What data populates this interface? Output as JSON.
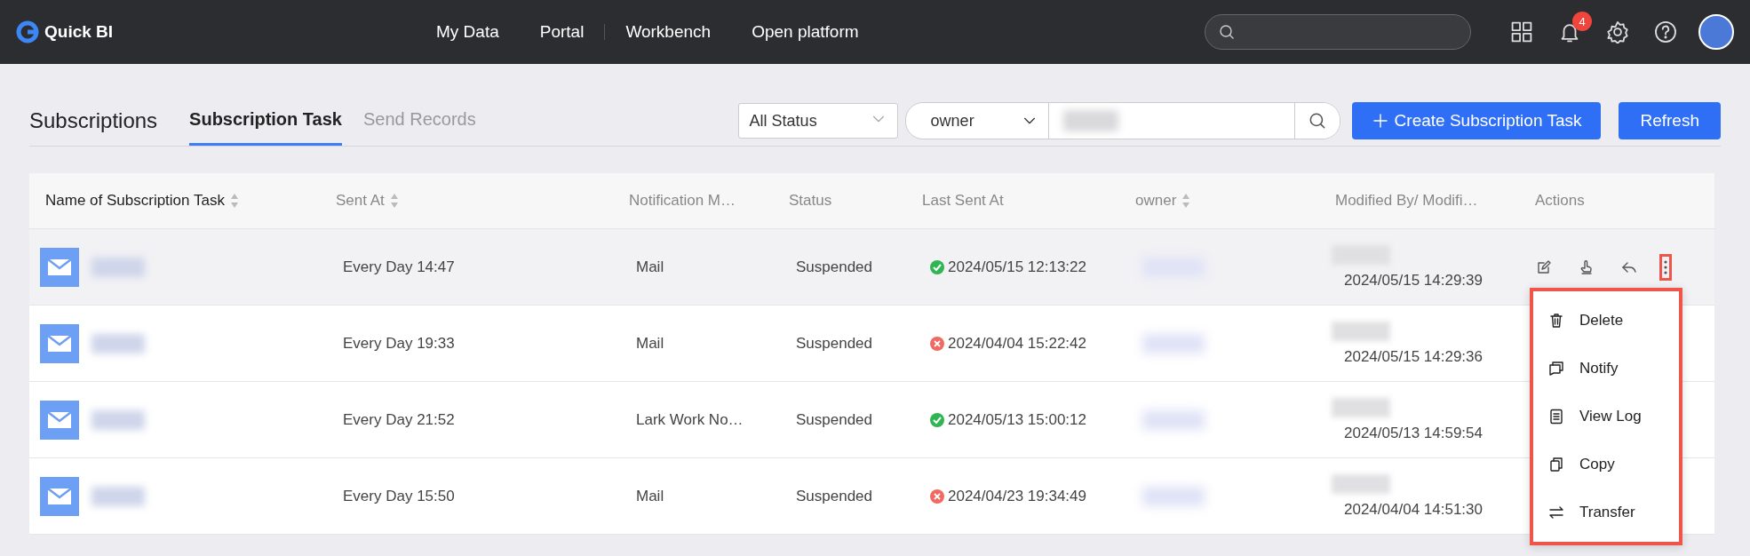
{
  "topbar": {
    "logo": "Quick BI",
    "nav": [
      {
        "label": "My Data"
      },
      {
        "label": "Portal"
      },
      {
        "label": "Workbench"
      },
      {
        "label": "Open platform"
      }
    ],
    "notification_count": "4"
  },
  "page": {
    "title": "Subscriptions",
    "tabs": [
      {
        "label": "Subscription Task",
        "selected": true
      },
      {
        "label": "Send Records",
        "selected": false
      }
    ],
    "status_filter": "All Status",
    "field_filter": "owner",
    "create_button": "Create Subscription Task",
    "refresh_button": "Refresh"
  },
  "table": {
    "columns": [
      {
        "label": "Name of Subscription Task",
        "sortable": true,
        "highlighted": true
      },
      {
        "label": "Sent At",
        "sortable": true,
        "highlighted": false
      },
      {
        "label": "Notification M…",
        "sortable": false,
        "highlighted": false
      },
      {
        "label": "Status",
        "sortable": false,
        "highlighted": false
      },
      {
        "label": "Last Sent At",
        "sortable": false,
        "highlighted": false
      },
      {
        "label": "owner",
        "sortable": true,
        "highlighted": false
      },
      {
        "label": "Modified By/ Modifi…",
        "sortable": false,
        "highlighted": false
      },
      {
        "label": "Actions",
        "sortable": false,
        "highlighted": false
      }
    ],
    "rows": [
      {
        "sent_at": "Every Day 14:47",
        "method": "Mail",
        "status": "Suspended",
        "last_sent": "2024/05/15 12:13:22",
        "succeeded": true,
        "modified": "2024/05/15 14:29:39",
        "hovered": true
      },
      {
        "sent_at": "Every Day 19:33",
        "method": "Mail",
        "status": "Suspended",
        "last_sent": "2024/04/04 15:22:42",
        "succeeded": false,
        "modified": "2024/05/15 14:29:36",
        "hovered": false
      },
      {
        "sent_at": "Every Day 21:52",
        "method": "Lark Work No…",
        "status": "Suspended",
        "last_sent": "2024/05/13 15:00:12",
        "succeeded": true,
        "modified": "2024/05/13 14:59:54",
        "hovered": false
      },
      {
        "sent_at": "Every Day 15:50",
        "method": "Mail",
        "status": "Suspended",
        "last_sent": "2024/04/23 19:34:49",
        "succeeded": false,
        "modified": "2024/04/04 14:51:30",
        "hovered": false
      }
    ]
  },
  "menu": {
    "items": [
      {
        "label": "Delete"
      },
      {
        "label": "Notify"
      },
      {
        "label": "View Log"
      },
      {
        "label": "Copy"
      },
      {
        "label": "Transfer"
      }
    ]
  }
}
